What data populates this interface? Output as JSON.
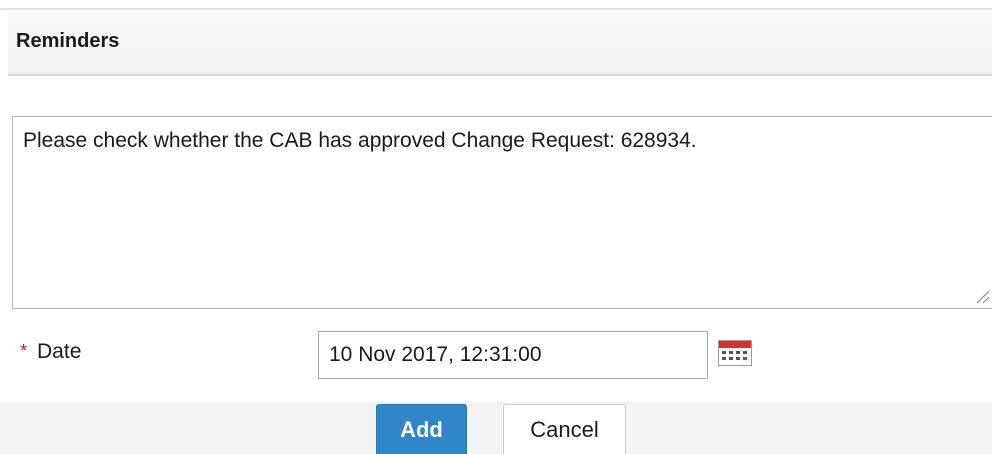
{
  "panel": {
    "title": "Reminders"
  },
  "reminder": {
    "text": "Please check whether the CAB has approved Change Request: 628934."
  },
  "date_field": {
    "required_marker": "*",
    "label": "Date",
    "value": "10 Nov 2017, 12:31:00"
  },
  "actions": {
    "add_label": "Add",
    "cancel_label": "Cancel"
  },
  "colors": {
    "primary_button": "#2f86c8",
    "required_star": "#e01010"
  },
  "icons": {
    "calendar": "calendar-icon",
    "resize": "resize-grip-icon"
  }
}
